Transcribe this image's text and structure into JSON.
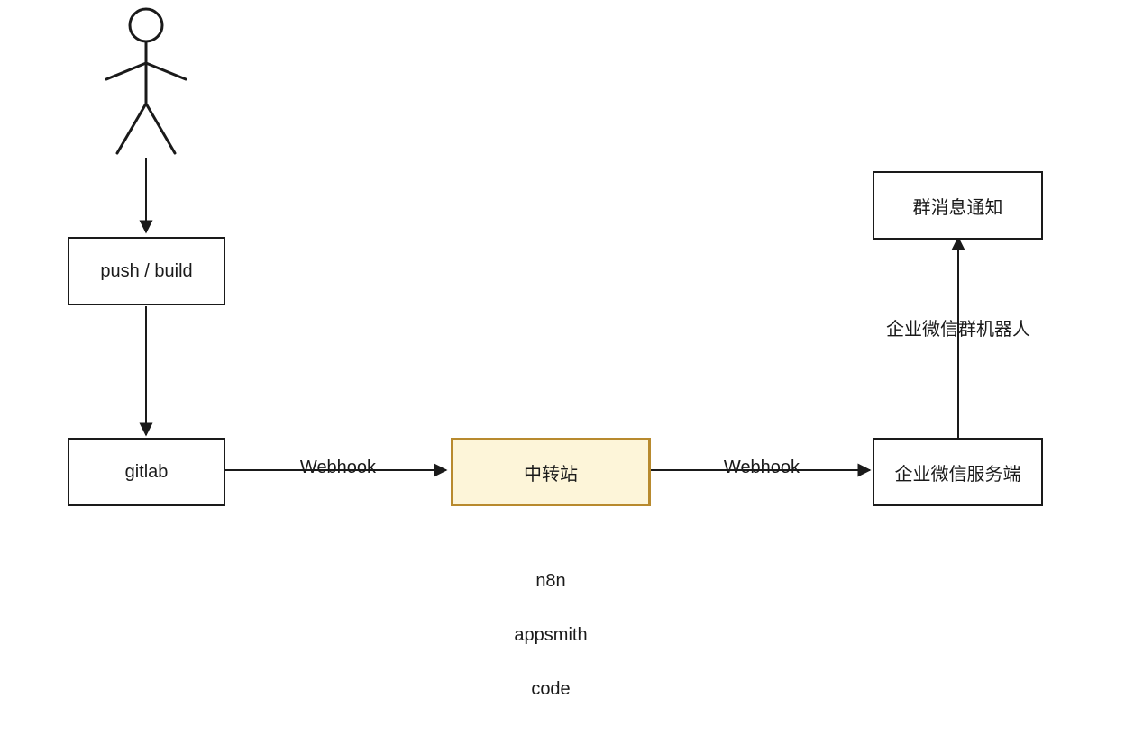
{
  "nodes": {
    "push_build": {
      "label": "push / build"
    },
    "gitlab": {
      "label": "gitlab"
    },
    "relay": {
      "label": "中转站"
    },
    "wecom_server": {
      "label": "企业微信服务端"
    },
    "group_notice": {
      "label": "群消息通知"
    }
  },
  "edges": {
    "webhook1": {
      "label": "Webhook"
    },
    "webhook2": {
      "label": "Webhook"
    },
    "wecom_bot": {
      "label": "企业微信群机器人"
    }
  },
  "relay_options": {
    "opt1": "n8n",
    "opt2": "appsmith",
    "opt3": "code"
  },
  "style": {
    "highlight_border": "#b88a2e",
    "highlight_fill": "#fdf5d9"
  }
}
